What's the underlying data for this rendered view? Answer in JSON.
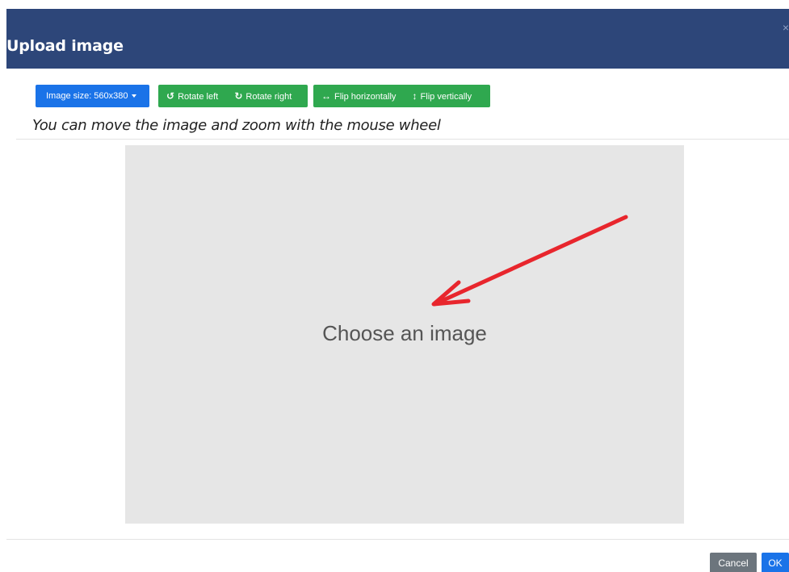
{
  "dialog": {
    "title": "Upload image",
    "close_glyph": "×"
  },
  "toolbar": {
    "image_size_label": "Image size: 560x380",
    "rotate_left_label": "Rotate left",
    "rotate_right_label": "Rotate right",
    "flip_horizontally_label": "Flip horizontally",
    "flip_vertically_label": "Flip vertically",
    "icons": {
      "rotate_left": "↺",
      "rotate_right": "↻",
      "flip_horizontally": "↔",
      "flip_vertically": "↕"
    }
  },
  "hint": "You can move the image and zoom with the mouse wheel",
  "canvas": {
    "placeholder": "Choose an image",
    "background": "#e6e6e6",
    "annotation_arrow_color": "#e8262d"
  },
  "footer": {
    "cancel_label": "Cancel",
    "ok_label": "OK"
  },
  "colors": {
    "header": "#2d4679",
    "primary": "#1a73e8",
    "success": "#2fa84f",
    "secondary": "#6c757d"
  }
}
